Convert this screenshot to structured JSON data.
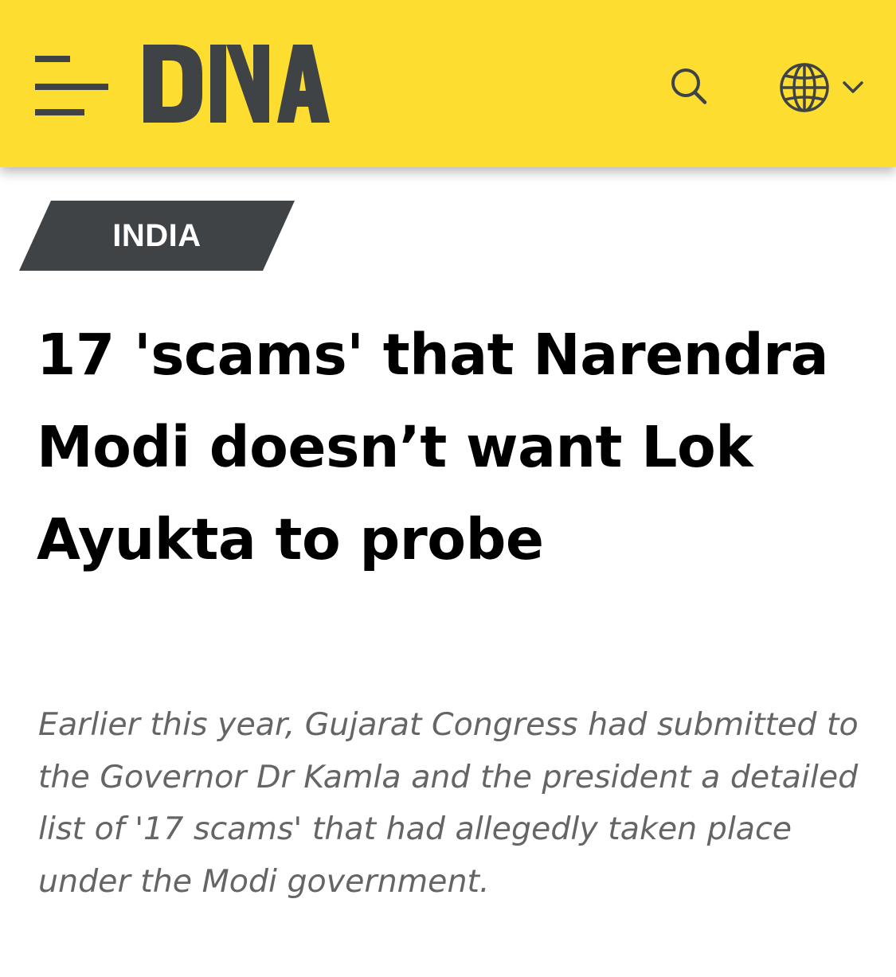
{
  "header": {
    "logo_text": "DNA",
    "icons": {
      "menu": "hamburger-menu-icon",
      "search": "search-icon",
      "language": "globe-icon",
      "dropdown": "chevron-down-icon"
    },
    "colors": {
      "background": "#fddd2f",
      "icon": "#3f4346"
    }
  },
  "article": {
    "category": "INDIA",
    "category_color": "#3f4346",
    "headline": "17 'scams' that Narendra Modi doesn’t want Lok Ayukta to probe",
    "summary": "Earlier this year, Gujarat Congress had submitted to the Governor Dr Kamla and the president a detailed list of '17 scams' that had allegedly taken place under the Modi government."
  }
}
